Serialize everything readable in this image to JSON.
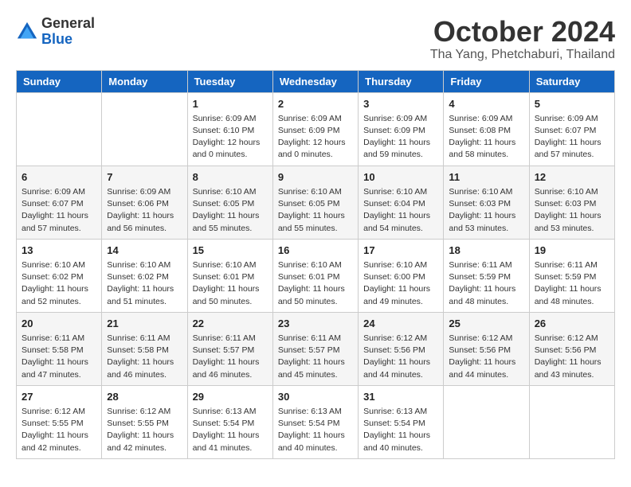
{
  "logo": {
    "general": "General",
    "blue": "Blue",
    "arrow_symbol": "▶"
  },
  "header": {
    "month_year": "October 2024",
    "location": "Tha Yang, Phetchaburi, Thailand"
  },
  "weekdays": [
    "Sunday",
    "Monday",
    "Tuesday",
    "Wednesday",
    "Thursday",
    "Friday",
    "Saturday"
  ],
  "weeks": [
    [
      {
        "day": "",
        "info": ""
      },
      {
        "day": "",
        "info": ""
      },
      {
        "day": "1",
        "info": "Sunrise: 6:09 AM\nSunset: 6:10 PM\nDaylight: 12 hours\nand 0 minutes."
      },
      {
        "day": "2",
        "info": "Sunrise: 6:09 AM\nSunset: 6:09 PM\nDaylight: 12 hours\nand 0 minutes."
      },
      {
        "day": "3",
        "info": "Sunrise: 6:09 AM\nSunset: 6:09 PM\nDaylight: 11 hours\nand 59 minutes."
      },
      {
        "day": "4",
        "info": "Sunrise: 6:09 AM\nSunset: 6:08 PM\nDaylight: 11 hours\nand 58 minutes."
      },
      {
        "day": "5",
        "info": "Sunrise: 6:09 AM\nSunset: 6:07 PM\nDaylight: 11 hours\nand 57 minutes."
      }
    ],
    [
      {
        "day": "6",
        "info": "Sunrise: 6:09 AM\nSunset: 6:07 PM\nDaylight: 11 hours\nand 57 minutes."
      },
      {
        "day": "7",
        "info": "Sunrise: 6:09 AM\nSunset: 6:06 PM\nDaylight: 11 hours\nand 56 minutes."
      },
      {
        "day": "8",
        "info": "Sunrise: 6:10 AM\nSunset: 6:05 PM\nDaylight: 11 hours\nand 55 minutes."
      },
      {
        "day": "9",
        "info": "Sunrise: 6:10 AM\nSunset: 6:05 PM\nDaylight: 11 hours\nand 55 minutes."
      },
      {
        "day": "10",
        "info": "Sunrise: 6:10 AM\nSunset: 6:04 PM\nDaylight: 11 hours\nand 54 minutes."
      },
      {
        "day": "11",
        "info": "Sunrise: 6:10 AM\nSunset: 6:03 PM\nDaylight: 11 hours\nand 53 minutes."
      },
      {
        "day": "12",
        "info": "Sunrise: 6:10 AM\nSunset: 6:03 PM\nDaylight: 11 hours\nand 53 minutes."
      }
    ],
    [
      {
        "day": "13",
        "info": "Sunrise: 6:10 AM\nSunset: 6:02 PM\nDaylight: 11 hours\nand 52 minutes."
      },
      {
        "day": "14",
        "info": "Sunrise: 6:10 AM\nSunset: 6:02 PM\nDaylight: 11 hours\nand 51 minutes."
      },
      {
        "day": "15",
        "info": "Sunrise: 6:10 AM\nSunset: 6:01 PM\nDaylight: 11 hours\nand 50 minutes."
      },
      {
        "day": "16",
        "info": "Sunrise: 6:10 AM\nSunset: 6:01 PM\nDaylight: 11 hours\nand 50 minutes."
      },
      {
        "day": "17",
        "info": "Sunrise: 6:10 AM\nSunset: 6:00 PM\nDaylight: 11 hours\nand 49 minutes."
      },
      {
        "day": "18",
        "info": "Sunrise: 6:11 AM\nSunset: 5:59 PM\nDaylight: 11 hours\nand 48 minutes."
      },
      {
        "day": "19",
        "info": "Sunrise: 6:11 AM\nSunset: 5:59 PM\nDaylight: 11 hours\nand 48 minutes."
      }
    ],
    [
      {
        "day": "20",
        "info": "Sunrise: 6:11 AM\nSunset: 5:58 PM\nDaylight: 11 hours\nand 47 minutes."
      },
      {
        "day": "21",
        "info": "Sunrise: 6:11 AM\nSunset: 5:58 PM\nDaylight: 11 hours\nand 46 minutes."
      },
      {
        "day": "22",
        "info": "Sunrise: 6:11 AM\nSunset: 5:57 PM\nDaylight: 11 hours\nand 46 minutes."
      },
      {
        "day": "23",
        "info": "Sunrise: 6:11 AM\nSunset: 5:57 PM\nDaylight: 11 hours\nand 45 minutes."
      },
      {
        "day": "24",
        "info": "Sunrise: 6:12 AM\nSunset: 5:56 PM\nDaylight: 11 hours\nand 44 minutes."
      },
      {
        "day": "25",
        "info": "Sunrise: 6:12 AM\nSunset: 5:56 PM\nDaylight: 11 hours\nand 44 minutes."
      },
      {
        "day": "26",
        "info": "Sunrise: 6:12 AM\nSunset: 5:56 PM\nDaylight: 11 hours\nand 43 minutes."
      }
    ],
    [
      {
        "day": "27",
        "info": "Sunrise: 6:12 AM\nSunset: 5:55 PM\nDaylight: 11 hours\nand 42 minutes."
      },
      {
        "day": "28",
        "info": "Sunrise: 6:12 AM\nSunset: 5:55 PM\nDaylight: 11 hours\nand 42 minutes."
      },
      {
        "day": "29",
        "info": "Sunrise: 6:13 AM\nSunset: 5:54 PM\nDaylight: 11 hours\nand 41 minutes."
      },
      {
        "day": "30",
        "info": "Sunrise: 6:13 AM\nSunset: 5:54 PM\nDaylight: 11 hours\nand 40 minutes."
      },
      {
        "day": "31",
        "info": "Sunrise: 6:13 AM\nSunset: 5:54 PM\nDaylight: 11 hours\nand 40 minutes."
      },
      {
        "day": "",
        "info": ""
      },
      {
        "day": "",
        "info": ""
      }
    ]
  ]
}
